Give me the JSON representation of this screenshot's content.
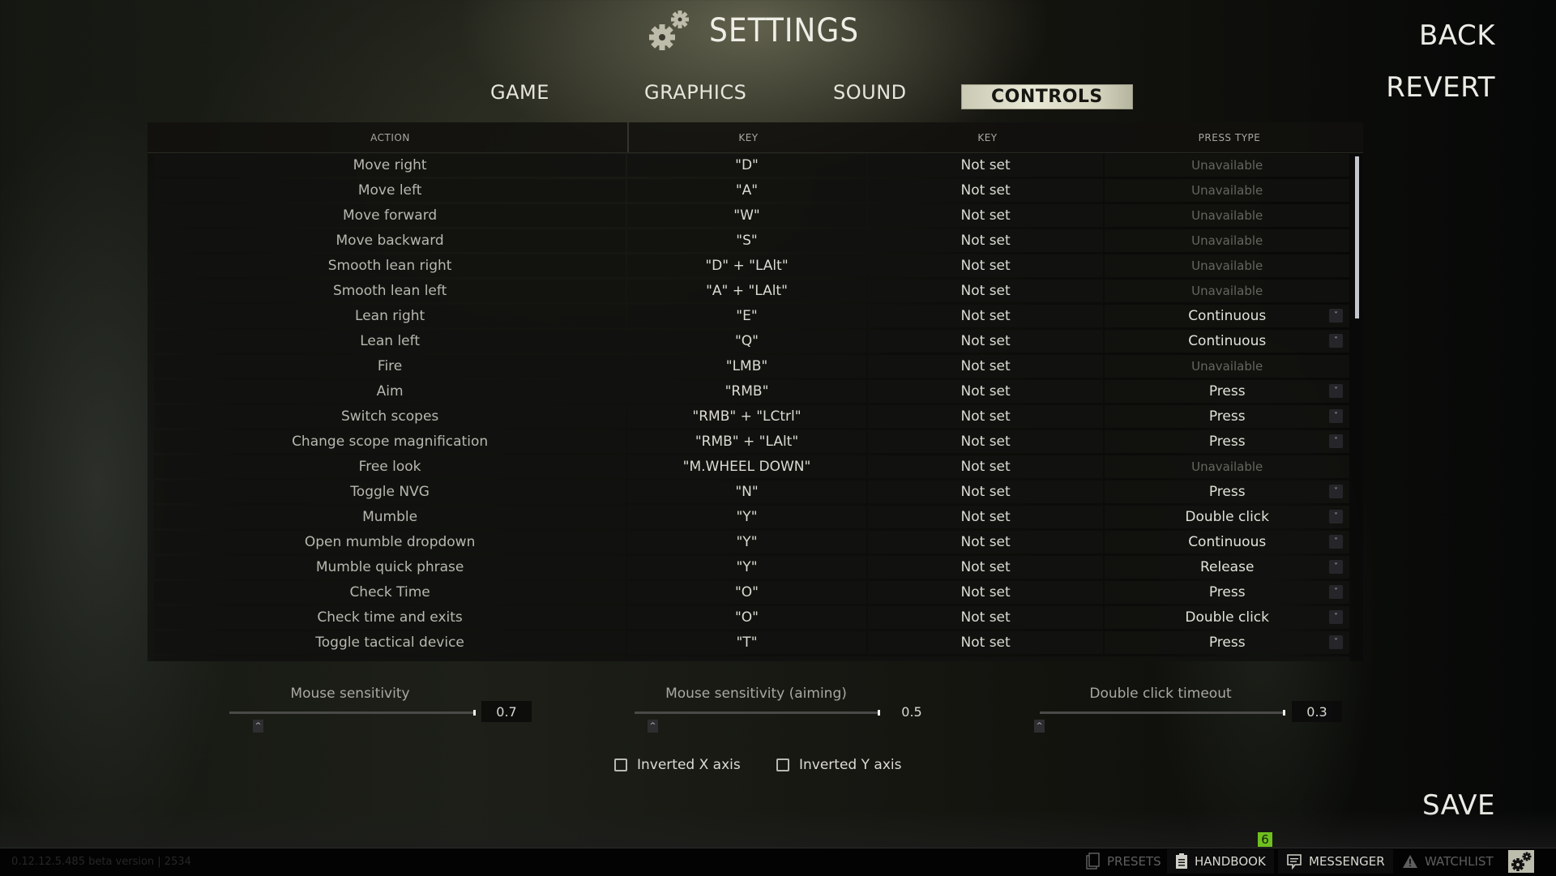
{
  "header": {
    "title": "SETTINGS",
    "title_icon": "gears-icon",
    "tabs": [
      {
        "label": "GAME",
        "active": false
      },
      {
        "label": "GRAPHICS",
        "active": false
      },
      {
        "label": "SOUND",
        "active": false
      },
      {
        "label": "CONTROLS",
        "active": true
      }
    ]
  },
  "side_buttons": {
    "back": "BACK",
    "revert": "REVERT",
    "save": "SAVE"
  },
  "table": {
    "columns": [
      "ACTION",
      "KEY",
      "KEY",
      "PRESS TYPE"
    ],
    "rows": [
      {
        "action": "Move right",
        "key1": "\"D\"",
        "key2": "Not set",
        "press": "Unavailable",
        "dropdown": false
      },
      {
        "action": "Move left",
        "key1": "\"A\"",
        "key2": "Not set",
        "press": "Unavailable",
        "dropdown": false
      },
      {
        "action": "Move forward",
        "key1": "\"W\"",
        "key2": "Not set",
        "press": "Unavailable",
        "dropdown": false
      },
      {
        "action": "Move backward",
        "key1": "\"S\"",
        "key2": "Not set",
        "press": "Unavailable",
        "dropdown": false
      },
      {
        "action": "Smooth lean right",
        "key1": "\"D\" + \"LAlt\"",
        "key2": "Not set",
        "press": "Unavailable",
        "dropdown": false
      },
      {
        "action": "Smooth lean left",
        "key1": "\"A\" + \"LAlt\"",
        "key2": "Not set",
        "press": "Unavailable",
        "dropdown": false
      },
      {
        "action": "Lean right",
        "key1": "\"E\"",
        "key2": "Not set",
        "press": "Continuous",
        "dropdown": true
      },
      {
        "action": "Lean left",
        "key1": "\"Q\"",
        "key2": "Not set",
        "press": "Continuous",
        "dropdown": true
      },
      {
        "action": "Fire",
        "key1": "\"LMB\"",
        "key2": "Not set",
        "press": "Unavailable",
        "dropdown": false
      },
      {
        "action": "Aim",
        "key1": "\"RMB\"",
        "key2": "Not set",
        "press": "Press",
        "dropdown": true
      },
      {
        "action": "Switch scopes",
        "key1": "\"RMB\" + \"LCtrl\"",
        "key2": "Not set",
        "press": "Press",
        "dropdown": true
      },
      {
        "action": "Change scope magnification",
        "key1": "\"RMB\" + \"LAlt\"",
        "key2": "Not set",
        "press": "Press",
        "dropdown": true
      },
      {
        "action": "Free look",
        "key1": "\"M.WHEEL DOWN\"",
        "key2": "Not set",
        "press": "Unavailable",
        "dropdown": false
      },
      {
        "action": "Toggle NVG",
        "key1": "\"N\"",
        "key2": "Not set",
        "press": "Press",
        "dropdown": true
      },
      {
        "action": "Mumble",
        "key1": "\"Y\"",
        "key2": "Not set",
        "press": "Double click",
        "dropdown": true
      },
      {
        "action": "Open mumble dropdown",
        "key1": "\"Y\"",
        "key2": "Not set",
        "press": "Continuous",
        "dropdown": true
      },
      {
        "action": "Mumble quick phrase",
        "key1": "\"Y\"",
        "key2": "Not set",
        "press": "Release",
        "dropdown": true
      },
      {
        "action": "Check Time",
        "key1": "\"O\"",
        "key2": "Not set",
        "press": "Press",
        "dropdown": true
      },
      {
        "action": "Check time and exits",
        "key1": "\"O\"",
        "key2": "Not set",
        "press": "Double click",
        "dropdown": true
      },
      {
        "action": "Toggle tactical device",
        "key1": "\"T\"",
        "key2": "Not set",
        "press": "Press",
        "dropdown": true
      }
    ],
    "scroll_position": 0.0
  },
  "sliders": [
    {
      "label": "Mouse sensitivity",
      "value": "0.7",
      "fill_fraction": 1.0,
      "step_symbol": "^"
    },
    {
      "label": "Mouse sensitivity (aiming)",
      "value": "0.5",
      "fill_fraction": 1.0,
      "step_symbol": "^"
    },
    {
      "label": "Double click timeout",
      "value": "0.3",
      "fill_fraction": 1.0,
      "step_symbol": "^"
    }
  ],
  "checkboxes": [
    {
      "label": "Inverted X axis",
      "checked": false
    },
    {
      "label": "Inverted Y axis",
      "checked": false
    }
  ],
  "bottom_bar": {
    "version": "0.12.12.5.485 beta version | 2534",
    "items": [
      {
        "label": "PRESETS",
        "icon": "presets-icon",
        "enabled": false
      },
      {
        "label": "HANDBOOK",
        "icon": "clipboard-icon",
        "enabled": true
      },
      {
        "label": "MESSENGER",
        "icon": "message-icon",
        "enabled": true
      },
      {
        "label": "WATCHLIST",
        "icon": "warning-icon",
        "enabled": false
      }
    ],
    "messenger_badge": "6",
    "settings_icon": "gears-icon"
  },
  "colors": {
    "accent_tab_bg": "#d9d9c4",
    "badge_green": "#6fbf1f",
    "scrollbar": "#c3c6cc"
  }
}
